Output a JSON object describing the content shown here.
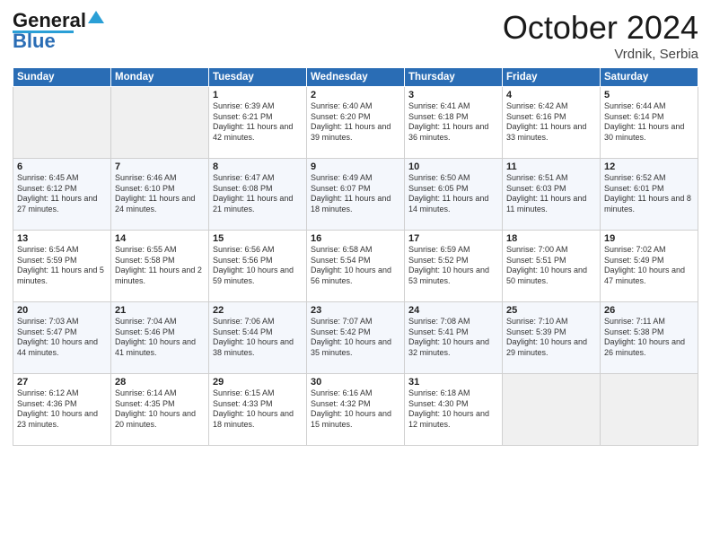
{
  "header": {
    "logo_general": "General",
    "logo_blue": "Blue",
    "title": "October 2024",
    "location": "Vrdnik, Serbia"
  },
  "days_of_week": [
    "Sunday",
    "Monday",
    "Tuesday",
    "Wednesday",
    "Thursday",
    "Friday",
    "Saturday"
  ],
  "weeks": [
    [
      {
        "day": "",
        "info": ""
      },
      {
        "day": "",
        "info": ""
      },
      {
        "day": "1",
        "info": "Sunrise: 6:39 AM\nSunset: 6:21 PM\nDaylight: 11 hours and 42 minutes."
      },
      {
        "day": "2",
        "info": "Sunrise: 6:40 AM\nSunset: 6:20 PM\nDaylight: 11 hours and 39 minutes."
      },
      {
        "day": "3",
        "info": "Sunrise: 6:41 AM\nSunset: 6:18 PM\nDaylight: 11 hours and 36 minutes."
      },
      {
        "day": "4",
        "info": "Sunrise: 6:42 AM\nSunset: 6:16 PM\nDaylight: 11 hours and 33 minutes."
      },
      {
        "day": "5",
        "info": "Sunrise: 6:44 AM\nSunset: 6:14 PM\nDaylight: 11 hours and 30 minutes."
      }
    ],
    [
      {
        "day": "6",
        "info": "Sunrise: 6:45 AM\nSunset: 6:12 PM\nDaylight: 11 hours and 27 minutes."
      },
      {
        "day": "7",
        "info": "Sunrise: 6:46 AM\nSunset: 6:10 PM\nDaylight: 11 hours and 24 minutes."
      },
      {
        "day": "8",
        "info": "Sunrise: 6:47 AM\nSunset: 6:08 PM\nDaylight: 11 hours and 21 minutes."
      },
      {
        "day": "9",
        "info": "Sunrise: 6:49 AM\nSunset: 6:07 PM\nDaylight: 11 hours and 18 minutes."
      },
      {
        "day": "10",
        "info": "Sunrise: 6:50 AM\nSunset: 6:05 PM\nDaylight: 11 hours and 14 minutes."
      },
      {
        "day": "11",
        "info": "Sunrise: 6:51 AM\nSunset: 6:03 PM\nDaylight: 11 hours and 11 minutes."
      },
      {
        "day": "12",
        "info": "Sunrise: 6:52 AM\nSunset: 6:01 PM\nDaylight: 11 hours and 8 minutes."
      }
    ],
    [
      {
        "day": "13",
        "info": "Sunrise: 6:54 AM\nSunset: 5:59 PM\nDaylight: 11 hours and 5 minutes."
      },
      {
        "day": "14",
        "info": "Sunrise: 6:55 AM\nSunset: 5:58 PM\nDaylight: 11 hours and 2 minutes."
      },
      {
        "day": "15",
        "info": "Sunrise: 6:56 AM\nSunset: 5:56 PM\nDaylight: 10 hours and 59 minutes."
      },
      {
        "day": "16",
        "info": "Sunrise: 6:58 AM\nSunset: 5:54 PM\nDaylight: 10 hours and 56 minutes."
      },
      {
        "day": "17",
        "info": "Sunrise: 6:59 AM\nSunset: 5:52 PM\nDaylight: 10 hours and 53 minutes."
      },
      {
        "day": "18",
        "info": "Sunrise: 7:00 AM\nSunset: 5:51 PM\nDaylight: 10 hours and 50 minutes."
      },
      {
        "day": "19",
        "info": "Sunrise: 7:02 AM\nSunset: 5:49 PM\nDaylight: 10 hours and 47 minutes."
      }
    ],
    [
      {
        "day": "20",
        "info": "Sunrise: 7:03 AM\nSunset: 5:47 PM\nDaylight: 10 hours and 44 minutes."
      },
      {
        "day": "21",
        "info": "Sunrise: 7:04 AM\nSunset: 5:46 PM\nDaylight: 10 hours and 41 minutes."
      },
      {
        "day": "22",
        "info": "Sunrise: 7:06 AM\nSunset: 5:44 PM\nDaylight: 10 hours and 38 minutes."
      },
      {
        "day": "23",
        "info": "Sunrise: 7:07 AM\nSunset: 5:42 PM\nDaylight: 10 hours and 35 minutes."
      },
      {
        "day": "24",
        "info": "Sunrise: 7:08 AM\nSunset: 5:41 PM\nDaylight: 10 hours and 32 minutes."
      },
      {
        "day": "25",
        "info": "Sunrise: 7:10 AM\nSunset: 5:39 PM\nDaylight: 10 hours and 29 minutes."
      },
      {
        "day": "26",
        "info": "Sunrise: 7:11 AM\nSunset: 5:38 PM\nDaylight: 10 hours and 26 minutes."
      }
    ],
    [
      {
        "day": "27",
        "info": "Sunrise: 6:12 AM\nSunset: 4:36 PM\nDaylight: 10 hours and 23 minutes."
      },
      {
        "day": "28",
        "info": "Sunrise: 6:14 AM\nSunset: 4:35 PM\nDaylight: 10 hours and 20 minutes."
      },
      {
        "day": "29",
        "info": "Sunrise: 6:15 AM\nSunset: 4:33 PM\nDaylight: 10 hours and 18 minutes."
      },
      {
        "day": "30",
        "info": "Sunrise: 6:16 AM\nSunset: 4:32 PM\nDaylight: 10 hours and 15 minutes."
      },
      {
        "day": "31",
        "info": "Sunrise: 6:18 AM\nSunset: 4:30 PM\nDaylight: 10 hours and 12 minutes."
      },
      {
        "day": "",
        "info": ""
      },
      {
        "day": "",
        "info": ""
      }
    ]
  ]
}
